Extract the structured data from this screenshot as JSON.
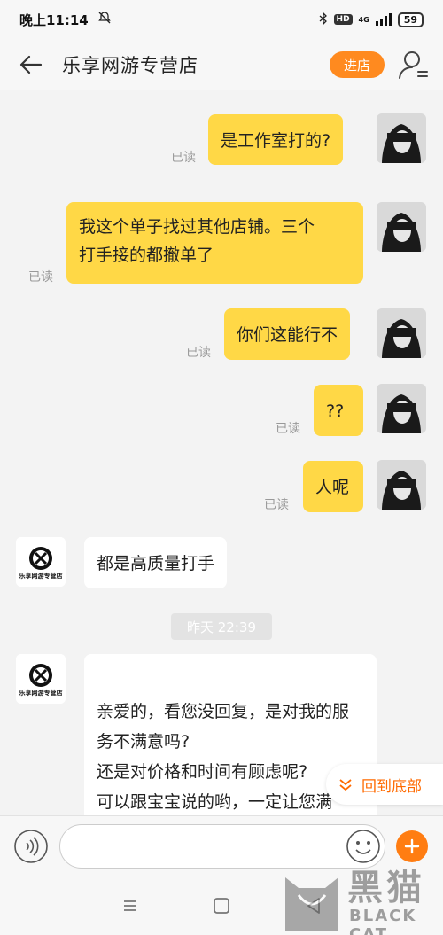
{
  "status_bar": {
    "time": "晚上11:14",
    "network_label": "HD",
    "network_type": "4G",
    "battery": "59"
  },
  "header": {
    "title": "乐享网游专营店",
    "enter_store_label": "进店"
  },
  "messages": [
    {
      "side": "right",
      "text": "是工作室打的?",
      "status": "已读"
    },
    {
      "side": "right",
      "text": "我这个单子找过其他店铺。三个打手接的都撤单了",
      "status": "已读"
    },
    {
      "side": "right",
      "text": "你们这能行不",
      "status": "已读"
    },
    {
      "side": "right",
      "text": "??",
      "status": "已读"
    },
    {
      "side": "right",
      "text": "人呢",
      "status": "已读"
    },
    {
      "side": "left",
      "text": "都是高质量打手"
    },
    {
      "side": "left",
      "text": "亲爱的，看您没回复，是对我的服务不满意吗?\n还是对价格和时间有顾虑呢?\n可以跟宝宝说的哟，一定让您满意。"
    }
  ],
  "shop_avatar_caption": "乐享网游专营店",
  "time_divider": "昨天 22:39",
  "scroll_to_bottom_label": "回到底部",
  "input": {
    "placeholder": ""
  },
  "watermark": {
    "cn": "黑猫",
    "en": "BLACK CAT"
  },
  "colors": {
    "accent": "#ff8a1f",
    "bubble_self": "#ffd846",
    "bubble_other": "#ffffff",
    "read_status": "#999999"
  }
}
